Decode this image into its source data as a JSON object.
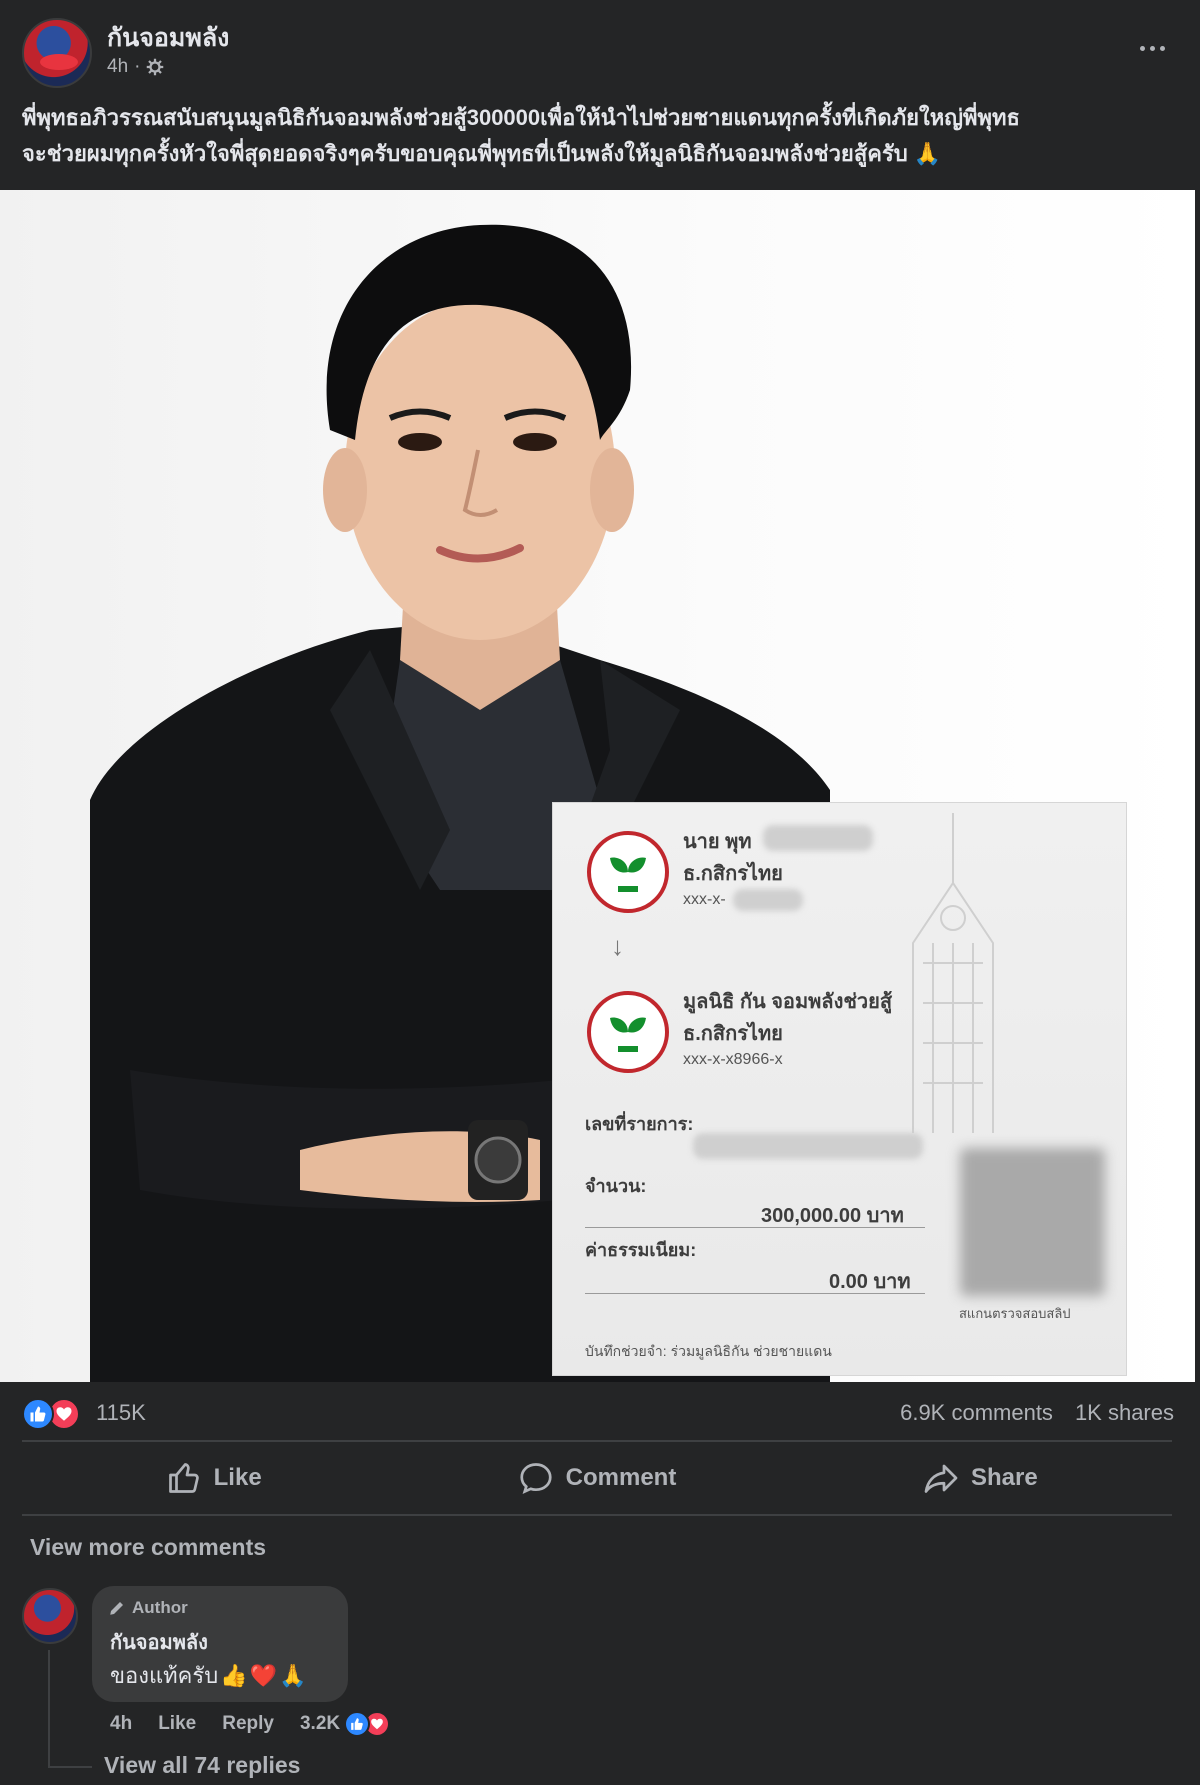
{
  "post": {
    "page_name": "กันจอมพลัง",
    "time": "4h",
    "separator": "·",
    "audience_icon": "gear-icon",
    "more_icon": "more-dots-icon",
    "caption_line1": "พี่พุทธอภิวรรณสนับสนุนมูลนิธิกันจอมพลังช่วยสู้300000เพื่อให้นำไปช่วยชายแดนทุกครั้งที่เกิดภัยใหญ่พี่พุทธ",
    "caption_line2": "จะช่วยผมทุกครั้งหัวใจพี่สุดยอดจริงๆครับขอบคุณพี่พุทธที่เป็นพลังให้มูลนิธิกันจอมพลังช่วยสู้ครับ",
    "caption_emoji": "🙏"
  },
  "receipt": {
    "sender_name": "นาย พุท",
    "sender_bank": "ธ.กสิกรไทย",
    "sender_account": "xxx-x-",
    "receiver_name": "มูลนิธิ กัน จอมพลังช่วยสู้",
    "receiver_bank": "ธ.กสิกรไทย",
    "receiver_account": "xxx-x-x8966-x",
    "ref_label": "เลขที่รายการ:",
    "amount_label": "จำนวน:",
    "amount_value": "300,000.00 บาท",
    "fee_label": "ค่าธรรมเนียม:",
    "fee_value": "0.00 บาท",
    "qr_caption": "สแกนตรวจสอบสลิป",
    "memo": "บันทึกช่วยจำ: ร่วมมูลนิธิกัน ช่วยชายแดน"
  },
  "stats": {
    "reaction_count": "115K",
    "comments": "6.9K comments",
    "shares": "1K shares"
  },
  "actions": {
    "like": "Like",
    "comment": "Comment",
    "share": "Share"
  },
  "comments": {
    "view_more": "View more comments",
    "author_badge": "Author",
    "name": "กันจอมพลัง",
    "text": "ของแท้ครับ",
    "emojis": [
      "👍",
      "❤️",
      "🙏"
    ],
    "time": "4h",
    "like": "Like",
    "reply": "Reply",
    "reaction_count": "3.2K",
    "view_replies": "View all 74 replies"
  },
  "colors": {
    "background": "#242526",
    "text_primary": "#e4e6eb",
    "text_secondary": "#b0b3b8",
    "like_blue": "#2d88ff",
    "love_red": "#f33e58",
    "kbank_red": "#c1272d",
    "kbank_green": "#138f2d"
  }
}
